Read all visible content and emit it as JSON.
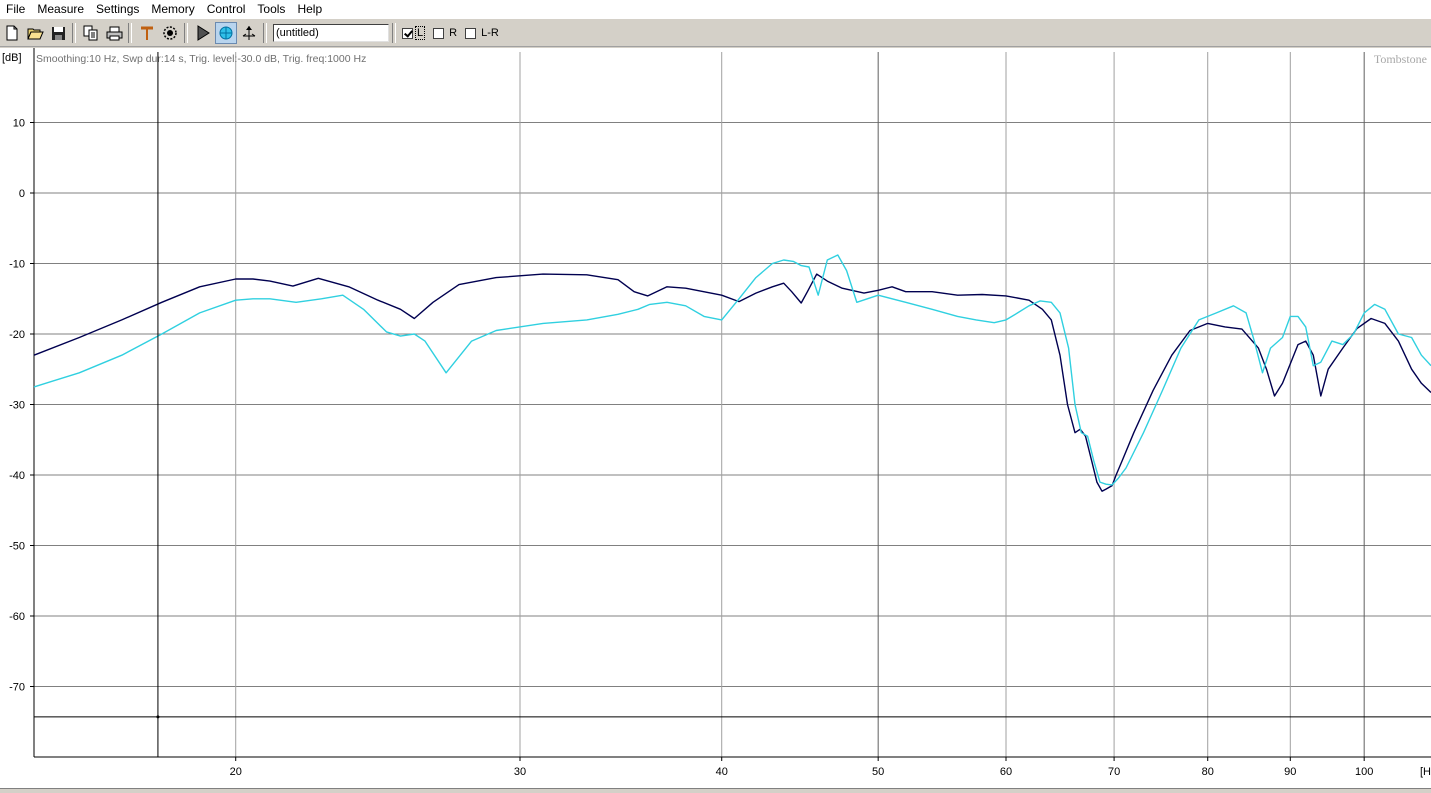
{
  "menu": [
    "File",
    "Measure",
    "Settings",
    "Memory",
    "Control",
    "Tools",
    "Help"
  ],
  "toolbar": {
    "buttons": [
      "new-file-icon",
      "open-folder-icon",
      "save-disk-icon",
      "copy-icon",
      "print-icon",
      "marker-icon",
      "target-icon",
      "play-icon",
      "measure-sphere-icon",
      "cursor-axes-icon"
    ],
    "title_value": "(untitled)",
    "channels": [
      {
        "label": "L",
        "checked": true
      },
      {
        "label": "R",
        "checked": false
      },
      {
        "label": "L-R",
        "checked": false
      }
    ]
  },
  "chart_data": {
    "type": "line",
    "info_text": "Smoothing:10 Hz, Swp dur:14 s, Trig. level:-30.0 dB, Trig. freq:1000 Hz",
    "watermark": "Tombstone",
    "ylabel": "[dB]",
    "xlabel": "[H",
    "x_scale": "log",
    "xlim": [
      15,
      110
    ],
    "ylim": [
      -80,
      20
    ],
    "x_ticks": [
      20,
      30,
      40,
      50,
      60,
      70,
      80,
      90,
      100
    ],
    "y_ticks": [
      10,
      0,
      -10,
      -20,
      -30,
      -40,
      -50,
      -60,
      -70
    ],
    "cursor": {
      "x": 17.9,
      "y": -74.3
    },
    "series": [
      {
        "color": "#000050",
        "x": [
          15,
          16,
          17,
          18,
          19,
          20,
          20.5,
          21,
          21.7,
          22.5,
          23.5,
          24.5,
          25.3,
          25.8,
          26.5,
          27.5,
          29,
          31,
          33,
          34.5,
          35.3,
          36,
          37,
          38,
          40,
          41,
          42,
          43,
          43.7,
          44.2,
          44.8,
          45.2,
          45.8,
          46.5,
          47.5,
          49,
          50,
          51,
          52,
          54,
          56,
          58,
          60,
          62,
          63.2,
          64,
          64.8,
          65.5,
          66.2,
          66.7,
          67.2,
          67.8,
          68.3,
          68.8,
          69.2,
          69.8,
          70.2,
          70.8,
          72,
          74,
          76,
          78,
          80,
          82,
          84,
          86,
          87,
          88,
          89,
          91,
          92,
          93,
          94,
          95,
          97,
          99,
          101,
          103,
          105,
          107,
          108.5,
          110
        ],
        "values": [
          -23,
          -20.5,
          -18,
          -15.5,
          -13.3,
          -12.2,
          -12.2,
          -12.5,
          -13.2,
          -12.1,
          -13.3,
          -15.2,
          -16.5,
          -17.8,
          -15.5,
          -13,
          -12,
          -11.5,
          -11.6,
          -12.3,
          -14,
          -14.6,
          -13.3,
          -13.5,
          -14.5,
          -15.4,
          -14.2,
          -13.3,
          -12.8,
          -14,
          -15.6,
          -14,
          -11.5,
          -12.5,
          -13.5,
          -14.2,
          -13.8,
          -13.3,
          -14,
          -14,
          -14.5,
          -14.4,
          -14.6,
          -15.2,
          -16.5,
          -18,
          -23,
          -30,
          -34,
          -33.5,
          -34.5,
          -38,
          -41,
          -42.3,
          -42,
          -41.5,
          -40,
          -38,
          -34,
          -28,
          -23,
          -19.5,
          -18.5,
          -19,
          -19.3,
          -22,
          -25,
          -28.8,
          -27,
          -21.5,
          -21,
          -23,
          -28.8,
          -25,
          -22,
          -19.2,
          -17.8,
          -18.5,
          -21,
          -25,
          -27,
          -28.3
        ]
      },
      {
        "color": "#30d0e0",
        "x": [
          15,
          16,
          17,
          18,
          19,
          20,
          20.5,
          21,
          21.8,
          22.6,
          23.3,
          24,
          24.8,
          25.3,
          25.8,
          26.2,
          27,
          28,
          29,
          31,
          33,
          34.5,
          35.5,
          36.1,
          37,
          38,
          39,
          40,
          41,
          42,
          43,
          43.7,
          44.3,
          44.8,
          45.3,
          45.9,
          46.5,
          47.2,
          47.8,
          48.5,
          50,
          52,
          54,
          56,
          57.5,
          59,
          60,
          61,
          62,
          63,
          64,
          64.8,
          65.6,
          66.2,
          66.8,
          67.4,
          68,
          68.6,
          69.2,
          69.8,
          70.4,
          71.2,
          73,
          75,
          77,
          79,
          81,
          83,
          84.5,
          85.5,
          86.5,
          87.5,
          89,
          90,
          91,
          92,
          93,
          94,
          95.5,
          97,
          98.5,
          100,
          101.5,
          103,
          105,
          107,
          108.5,
          110
        ],
        "values": [
          -27.5,
          -25.5,
          -23,
          -20,
          -17,
          -15.2,
          -15,
          -15,
          -15.5,
          -15,
          -14.5,
          -16.5,
          -19.7,
          -20.3,
          -20,
          -21,
          -25.5,
          -21,
          -19.5,
          -18.5,
          -18,
          -17.2,
          -16.5,
          -15.8,
          -15.5,
          -16,
          -17.5,
          -18,
          -15,
          -12,
          -10,
          -9.5,
          -9.7,
          -10.3,
          -10.5,
          -14.5,
          -9.5,
          -8.8,
          -11,
          -15.5,
          -14.5,
          -15.5,
          -16.5,
          -17.5,
          -18,
          -18.4,
          -18,
          -17,
          -16,
          -15.3,
          -15.5,
          -17,
          -22,
          -30,
          -34,
          -34.5,
          -38,
          -41,
          -41.3,
          -41.4,
          -40.5,
          -39,
          -34,
          -28,
          -22,
          -18,
          -17,
          -16,
          -17,
          -21,
          -25.5,
          -22,
          -20.5,
          -17.5,
          -17.5,
          -19,
          -24.5,
          -24,
          -21,
          -21.5,
          -20,
          -17,
          -15.8,
          -16.5,
          -20,
          -20.5,
          -23,
          -24.5
        ]
      }
    ]
  }
}
